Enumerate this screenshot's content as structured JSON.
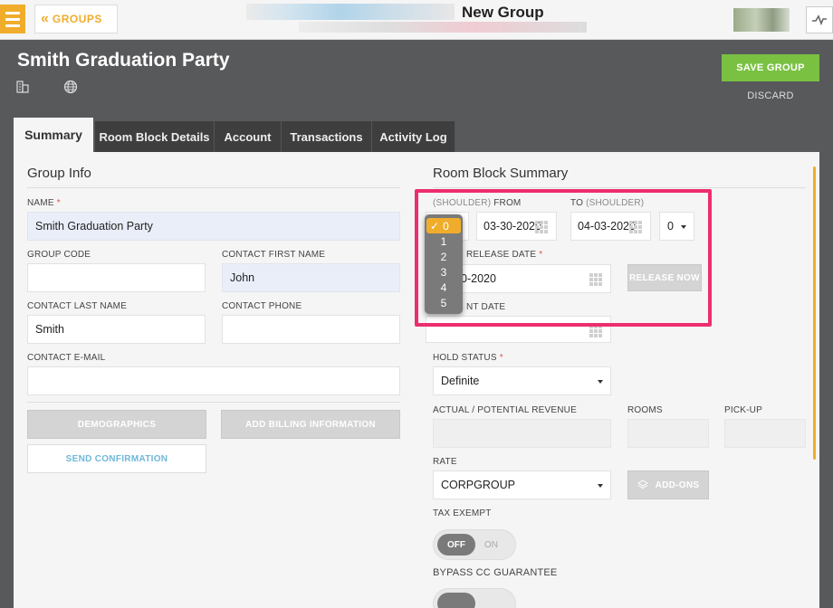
{
  "topbar": {
    "groups_label": "GROUPS",
    "title": "New Group"
  },
  "header": {
    "group_name": "Smith Graduation Party",
    "save_label": "SAVE GROUP",
    "discard_label": "DISCARD"
  },
  "tabs": [
    {
      "label": "Summary",
      "active": true
    },
    {
      "label": "Room Block Details",
      "active": false
    },
    {
      "label": "Account",
      "active": false
    },
    {
      "label": "Transactions",
      "active": false
    },
    {
      "label": "Activity Log",
      "active": false
    }
  ],
  "group_info": {
    "title": "Group Info",
    "name_label": "NAME",
    "name_value": "Smith Graduation Party",
    "group_code_label": "GROUP CODE",
    "group_code_value": "",
    "contact_first_label": "CONTACT FIRST NAME",
    "contact_first_value": "John",
    "contact_last_label": "CONTACT LAST NAME",
    "contact_last_value": "Smith",
    "contact_phone_label": "CONTACT PHONE",
    "contact_phone_value": "",
    "contact_email_label": "CONTACT E-MAIL",
    "contact_email_value": "",
    "demographics_label": "DEMOGRAPHICS",
    "billing_label": "ADD BILLING INFORMATION",
    "send_confirmation_label": "SEND CONFIRMATION"
  },
  "room_block": {
    "title": "Room Block Summary",
    "shoulder_prefix": "(SHOULDER)",
    "from_label": "FROM",
    "from_value": "03-30-2020",
    "to_label": "TO",
    "to_shoulder": "(SHOULDER)",
    "to_value": "04-03-2020",
    "shoulder_after_value": "0",
    "release_date_label": "RELEASE DATE",
    "release_date_value": "0-2020",
    "release_now_label": "RELEASE NOW",
    "cutoff_label": "NT DATE",
    "hold_status_label": "HOLD STATUS",
    "hold_status_value": "Definite",
    "revenue_label": "ACTUAL / POTENTIAL REVENUE",
    "rooms_label": "ROOMS",
    "pickup_label": "PICK-UP",
    "rate_label": "RATE",
    "rate_value": "CORPGROUP",
    "addons_label": "ADD-ONS",
    "tax_exempt_label": "TAX EXEMPT",
    "tax_off": "OFF",
    "tax_on": "ON",
    "bypass_label": "BYPASS CC GUARANTEE"
  },
  "shoulder_dropdown": {
    "checkmark": "✓",
    "options": [
      "0",
      "1",
      "2",
      "3",
      "4",
      "5"
    ],
    "selected": "0"
  }
}
